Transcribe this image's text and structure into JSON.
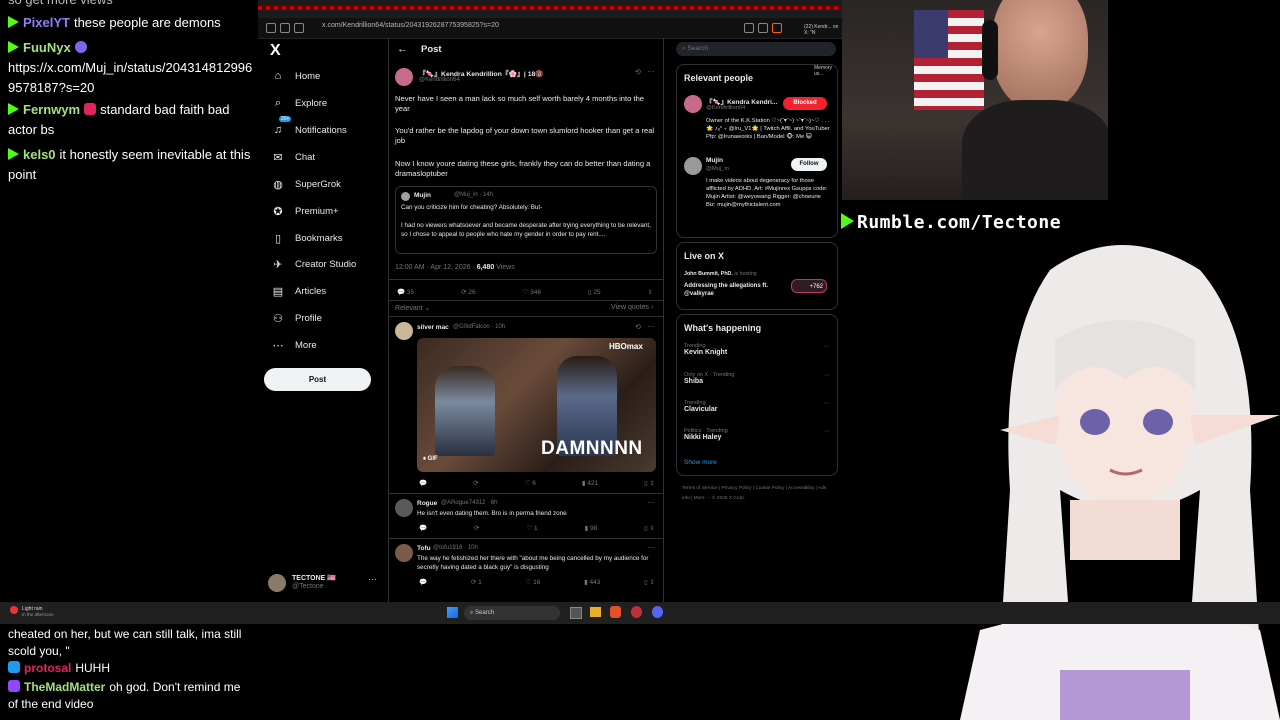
{
  "chat_top": {
    "line0": "so get more views",
    "line1": {
      "user": "PixelYT",
      "text": "these people are demons"
    },
    "line2": {
      "user": "FuuNyx",
      "text": "https://x.com/Muj_in/status/2043148129969578187?s=20"
    },
    "line3": {
      "user": "Fernwym",
      "text": "standard bad faith bad actor bs"
    },
    "line4": {
      "user": "kels0",
      "text": "it honestly seem inevitable at this point"
    }
  },
  "browser": {
    "url": "x.com/Kendrillion64/status/2043192628775395825?s=20",
    "tab_title": "(22) Kendr... on X: \"N",
    "menu_hint": "Memory us..."
  },
  "x_nav": {
    "logo": "X",
    "items": [
      {
        "label": "Home",
        "icon": "⌂"
      },
      {
        "label": "Explore",
        "icon": "⌕"
      },
      {
        "label": "Notifications",
        "icon": "♫",
        "badge": "20+"
      },
      {
        "label": "Chat",
        "icon": "✉"
      },
      {
        "label": "SuperGrok",
        "icon": "◍"
      },
      {
        "label": "Premium+",
        "icon": "✪"
      },
      {
        "label": "Bookmarks",
        "icon": "▯"
      },
      {
        "label": "Creator Studio",
        "icon": "✈"
      },
      {
        "label": "Articles",
        "icon": "▤"
      },
      {
        "label": "Profile",
        "icon": "⚇"
      },
      {
        "label": "More",
        "icon": "⋯"
      }
    ],
    "post_button": "Post",
    "profile": {
      "name": "TECTONE 🇺🇸",
      "handle": "@Tectone",
      "more": "···"
    }
  },
  "main": {
    "header": "Post",
    "tweet": {
      "name": "『🍬』Kendra Kendrillion『🌸』| 18🔞",
      "handle": "@Kendrillion64",
      "p1": "Never have I seen a man lack so much self worth barely 4 months into the year",
      "p2": "You'd rather be the lapdog of your down town slumlord hooker than get a real job",
      "p3": "Now I know youre dating these girls, frankly they can do better than dating a dramasloptuber",
      "quote": {
        "name": "Mujin",
        "handle": "@Muj_in · 14h",
        "l1": "Can you criticize him for cheating? Absolutely. But-",
        "l2": "I had no viewers whatsoever and became desperate after trying everything to be relevant, so I chose to appeal to people who hate my gender in order to pay rent...."
      },
      "time": "12:00 AM · Apr 12, 2026 · ",
      "views": "6,480",
      "views_label": " Views",
      "replies": "35",
      "reposts": "26",
      "likes": "346",
      "bookmarks": "25",
      "relevant": "Relevant ⌄",
      "view_quotes": "View quotes ›"
    },
    "reply1": {
      "name": "silver mac",
      "handle": "@G0ldFalcon · 10h",
      "gif_brand": "HBOmax",
      "gif_caption": "DAMNNNN",
      "gif_label": "GIF",
      "likes": "6",
      "views": "421"
    },
    "reply2": {
      "name": "Rogue",
      "handle": "@ARogue74312 · 6h",
      "text": "He isn't even dating them. Bro is in perma friend zone",
      "likes": "1",
      "views": "98"
    },
    "reply3": {
      "name": "Tofu",
      "handle": "@tofu1916 · 10h",
      "text": "The way he fetishized her there with \"about me being cancelled by my audience for secretly having dated a black guy\" is disgusting",
      "reposts": "1",
      "likes": "16",
      "views": "443"
    }
  },
  "sidebar": {
    "search_placeholder": "Search",
    "relevant_title": "Relevant people",
    "person1": {
      "name": "『🍬』Kendra Kendri...",
      "handle": "@Kendrillion64",
      "button": "Blocked",
      "bio": "Owner of the K.K.Station ♡~(˘▾˘~) ~˘▾˘~)~♡ . . .🌟 ♪ₒ° ₊ @Iru_V1🌟 | Twitch Affil. and YouTuber Pfp: @Irunaworks | Ban/Model 🐵: Me 😺"
    },
    "person2": {
      "name": "Mujin",
      "handle": "@Muj_in",
      "button": "Follow",
      "bio": "I make videos about degeneracy for those afflicted by ADHD. Art: #Mujinrex Gsupps code: Mujin Artist: @weyowang Rigger: @choeurie Biz: mujin@mythictalent.com"
    },
    "live_title": "Live on X",
    "live": {
      "host": "John Bummit, PhD.",
      "status": "is hosting",
      "title": "Addressing the allegations ft. @valkyrae",
      "count": "+762"
    },
    "happening_title": "What's happening",
    "trends": [
      {
        "context": "Trending",
        "name": "Kevin Knight"
      },
      {
        "context": "Only on X · Trending",
        "name": "Shiba"
      },
      {
        "context": "Trending",
        "name": "Clavicular"
      },
      {
        "context": "Politics · Trending",
        "name": "Nikki Haley"
      }
    ],
    "show_more": "Show more",
    "footer": "Terms of Service | Privacy Policy | Cookie Policy | Accessibility | Ads info | More ··· © 2026 X Corp."
  },
  "taskbar": {
    "weather": "Light rain",
    "weather_sub": "In the afternoon",
    "search": "Search"
  },
  "overlay": {
    "rumble": "Rumble.com/Tectone"
  },
  "chat_bottom": {
    "line1": "cheated on her, but we can still talk, ima still scold you, \"",
    "line2": {
      "user": "protosal",
      "text": "HUHH"
    },
    "line3": {
      "user": "TheMadMatter",
      "text": "oh god. Don't remind me of the end video"
    }
  },
  "colors": {
    "kick_green": "#53fc18",
    "x_blue": "#1d9bf0",
    "blocked_red": "#f4212e"
  }
}
